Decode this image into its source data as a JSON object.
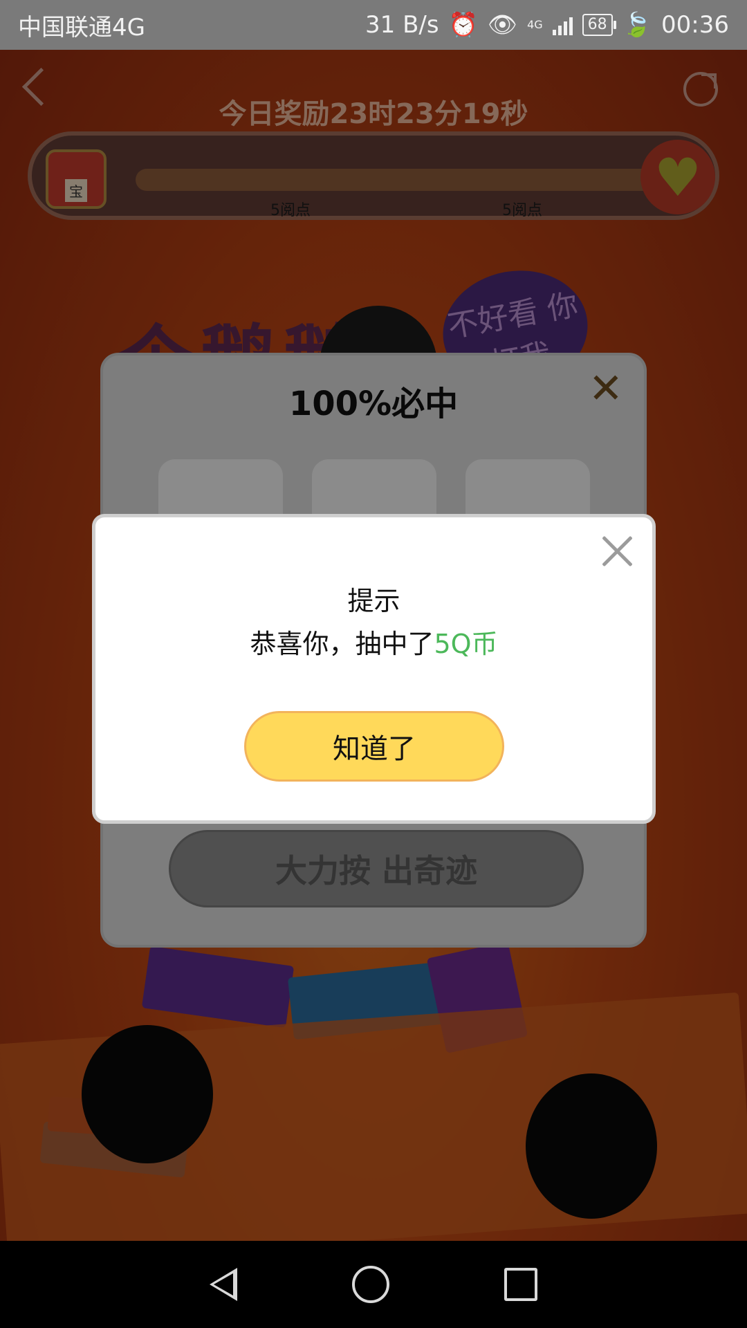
{
  "status_bar": {
    "carrier": "中国联通4G",
    "speed": "31 B/s",
    "network": "4G",
    "battery": "68",
    "time": "00:36"
  },
  "header": {
    "countdown": "今日奖励23时23分19秒",
    "chest_label": "宝",
    "milestones": [
      "5阅点",
      "5阅点"
    ]
  },
  "background": {
    "poster_text": "个鹅鹅",
    "bubble_text": "不好看 你打我"
  },
  "lottery": {
    "title": "100%必中",
    "press_button": "大力按 出奇迹"
  },
  "modal": {
    "title": "提示",
    "message_prefix": "恭喜你，抽中了",
    "prize": "5Q币",
    "ok_button": "知道了",
    "prize_color": "#4cb85a",
    "button_color": "#ffd95a"
  }
}
